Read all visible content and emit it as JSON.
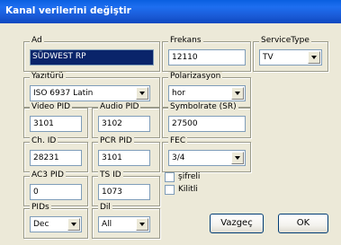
{
  "window": {
    "title": "Kanal verilerini değiştir"
  },
  "groups": {
    "ad": {
      "label": "Ad",
      "value": "SÜDWEST RP"
    },
    "frekans": {
      "label": "Frekans",
      "value": "12110"
    },
    "service_type": {
      "label": "ServiceType",
      "value": "TV"
    },
    "yazitur": {
      "label": "Yazıtürü",
      "value": "ISO 6937 Latin"
    },
    "polarizasyon": {
      "label": "Polarizasyon",
      "value": "hor"
    },
    "video_pid": {
      "label": "Video PID",
      "value": "3101"
    },
    "audio_pid": {
      "label": "Audio PID",
      "value": "3102"
    },
    "symbolrate": {
      "label": "Symbolrate (SR)",
      "value": "27500"
    },
    "ch_id": {
      "label": "Ch. ID",
      "value": "28231"
    },
    "pcr_pid": {
      "label": "PCR PID",
      "value": "3101"
    },
    "fec": {
      "label": "FEC",
      "value": "3/4"
    },
    "ac3_pid": {
      "label": "AC3 PID",
      "value": "0"
    },
    "ts_id": {
      "label": "TS ID",
      "value": "1073"
    },
    "pids": {
      "label": "PIDs",
      "value": "Dec"
    },
    "dil": {
      "label": "Dil",
      "value": "All"
    }
  },
  "checkboxes": {
    "sifreli": "şifreli",
    "kilitli": "Kilitli"
  },
  "buttons": {
    "cancel": "Vazgeç",
    "ok": "OK"
  }
}
